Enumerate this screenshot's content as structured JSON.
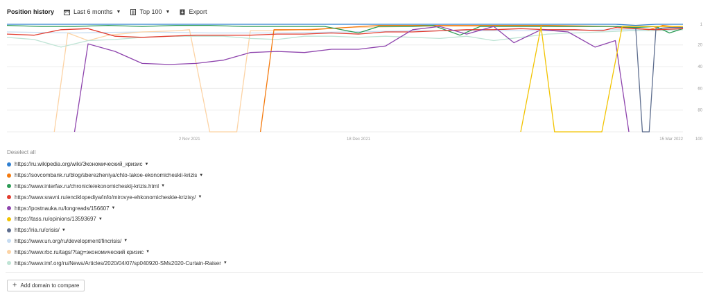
{
  "toolbar": {
    "title": "Position history",
    "period": "Last 6 months",
    "top": "Top 100",
    "export": "Export"
  },
  "deselect_all": "Deselect all",
  "add_domain": "Add domain to compare",
  "legend": [
    {
      "url": "https://ru.wikipedia.org/wiki/Экономический_кризис",
      "color": "#2f7fd1"
    },
    {
      "url": "https://sovcombank.ru/blog/sberezheniya/chto-takoe-ekonomicheskii-krizis",
      "color": "#f47a0e"
    },
    {
      "url": "https://www.interfax.ru/chronicle/ekonomicheskij-krizis.html",
      "color": "#2c9b55"
    },
    {
      "url": "https://www.sravni.ru/enciklopediya/info/mirovye-ehkonomicheskie-krizisy/",
      "color": "#e23b2e"
    },
    {
      "url": "https://postnauka.ru/longreads/156607",
      "color": "#8e44ad"
    },
    {
      "url": "https://tass.ru/opinions/13593697",
      "color": "#f2c300"
    },
    {
      "url": "https://ria.ru/crisis/",
      "color": "#5d6d8e"
    },
    {
      "url": "https://www.un.org/ru/development/fincrisis/",
      "color": "#c6dcf2"
    },
    {
      "url": "https://www.rbc.ru/tags/?tag=экономический кризис",
      "color": "#fcd3a5"
    },
    {
      "url": "https://www.imf.org/ru/News/Articles/2020/04/07/sp040920-SMs2020-Curtain-Raiser",
      "color": "#bfe4d5"
    }
  ],
  "chart_data": {
    "type": "line",
    "ylim": [
      1,
      100
    ],
    "y_ticks": [
      1,
      20,
      40,
      60,
      80,
      100
    ],
    "x_ticks": [
      {
        "label": "2 Nov 2021",
        "pos": 0.27
      },
      {
        "label": "18 Dec 2021",
        "pos": 0.52
      },
      {
        "label": "15 Mar 2022",
        "pos": 1.0
      }
    ],
    "series": [
      {
        "name": "https://ru.wikipedia.org/wiki/Экономический_кризис",
        "color": "#2f7fd1",
        "values": [
          [
            0,
            1
          ],
          [
            0.25,
            1
          ],
          [
            0.5,
            1
          ],
          [
            0.75,
            1
          ],
          [
            0.9,
            1
          ],
          [
            0.93,
            2
          ],
          [
            0.96,
            1
          ],
          [
            1,
            1
          ]
        ]
      },
      {
        "name": "https://sovcombank.ru/blog/sberezheniya/chto-takoe-ekonomicheskii-krizis",
        "color": "#f47a0e",
        "values": [
          [
            0.375,
            100
          ],
          [
            0.395,
            6
          ],
          [
            0.45,
            6
          ],
          [
            0.55,
            2
          ],
          [
            0.6,
            2
          ],
          [
            0.7,
            2
          ],
          [
            0.8,
            2
          ],
          [
            0.9,
            3
          ],
          [
            0.95,
            6
          ],
          [
            0.97,
            2
          ],
          [
            1,
            4
          ]
        ]
      },
      {
        "name": "https://www.interfax.ru/chronicle/ekonomicheskij-krizis.html",
        "color": "#2c9b55",
        "values": [
          [
            0,
            2
          ],
          [
            0.05,
            3
          ],
          [
            0.1,
            3
          ],
          [
            0.15,
            2
          ],
          [
            0.2,
            3
          ],
          [
            0.25,
            2
          ],
          [
            0.3,
            2
          ],
          [
            0.35,
            3
          ],
          [
            0.4,
            3
          ],
          [
            0.45,
            3
          ],
          [
            0.47,
            3
          ],
          [
            0.52,
            9
          ],
          [
            0.55,
            3
          ],
          [
            0.6,
            3
          ],
          [
            0.63,
            2
          ],
          [
            0.67,
            11
          ],
          [
            0.7,
            3
          ],
          [
            0.75,
            3
          ],
          [
            0.8,
            3
          ],
          [
            0.85,
            3
          ],
          [
            0.9,
            3
          ],
          [
            0.93,
            4
          ],
          [
            0.96,
            3
          ],
          [
            0.98,
            9
          ],
          [
            1,
            5
          ]
        ]
      },
      {
        "name": "https://www.sravni.ru/enciklopediya/info/mirovye-ehkonomicheskie-krizisy/",
        "color": "#e23b2e",
        "values": [
          [
            0,
            10
          ],
          [
            0.04,
            11
          ],
          [
            0.08,
            6
          ],
          [
            0.12,
            5
          ],
          [
            0.16,
            12
          ],
          [
            0.2,
            13
          ],
          [
            0.24,
            12
          ],
          [
            0.28,
            11
          ],
          [
            0.32,
            11
          ],
          [
            0.36,
            11
          ],
          [
            0.4,
            10
          ],
          [
            0.44,
            10
          ],
          [
            0.48,
            9
          ],
          [
            0.52,
            10
          ],
          [
            0.56,
            8
          ],
          [
            0.6,
            8
          ],
          [
            0.64,
            7
          ],
          [
            0.68,
            6
          ],
          [
            0.72,
            6
          ],
          [
            0.76,
            5
          ],
          [
            0.8,
            6
          ],
          [
            0.84,
            6
          ],
          [
            0.88,
            7
          ],
          [
            0.9,
            4
          ],
          [
            0.93,
            5
          ],
          [
            0.96,
            6
          ],
          [
            1,
            5
          ]
        ]
      },
      {
        "name": "https://postnauka.ru/longreads/156607",
        "color": "#8e44ad",
        "values": [
          [
            0.1,
            100
          ],
          [
            0.12,
            19
          ],
          [
            0.16,
            26
          ],
          [
            0.2,
            37
          ],
          [
            0.24,
            38
          ],
          [
            0.28,
            37
          ],
          [
            0.32,
            34
          ],
          [
            0.36,
            27
          ],
          [
            0.4,
            26
          ],
          [
            0.44,
            27
          ],
          [
            0.48,
            24
          ],
          [
            0.52,
            24
          ],
          [
            0.56,
            21
          ],
          [
            0.6,
            6
          ],
          [
            0.64,
            3
          ],
          [
            0.68,
            10
          ],
          [
            0.72,
            3
          ],
          [
            0.75,
            18
          ],
          [
            0.79,
            6
          ],
          [
            0.83,
            8
          ],
          [
            0.87,
            22
          ],
          [
            0.9,
            16
          ],
          [
            0.92,
            100
          ]
        ]
      },
      {
        "name": "https://tass.ru/opinions/13593697",
        "color": "#f2c300",
        "values": [
          [
            0.76,
            100
          ],
          [
            0.79,
            3
          ],
          [
            0.81,
            100
          ],
          [
            0.88,
            100
          ],
          [
            0.91,
            3
          ],
          [
            0.93,
            3
          ],
          [
            0.96,
            3
          ],
          [
            1,
            3
          ]
        ]
      },
      {
        "name": "https://ria.ru/crisis/",
        "color": "#5d6d8e",
        "values": [
          [
            0.93,
            4
          ],
          [
            0.94,
            100
          ],
          [
            0.95,
            100
          ],
          [
            0.96,
            5
          ],
          [
            0.98,
            4
          ],
          [
            1,
            4
          ]
        ]
      },
      {
        "name": "https://www.un.org/ru/development/fincrisis/",
        "color": "#c6dcf2",
        "values": [
          [
            0,
            8
          ],
          [
            0.1,
            9
          ],
          [
            0.2,
            8
          ],
          [
            0.3,
            9
          ],
          [
            0.4,
            9
          ],
          [
            0.5,
            8
          ],
          [
            0.6,
            7
          ],
          [
            0.7,
            7
          ],
          [
            0.8,
            7
          ],
          [
            0.9,
            6
          ],
          [
            1,
            6
          ]
        ]
      },
      {
        "name": "https://www.rbc.ru/tags/?tag=экономический кризис",
        "color": "#fcd3a5",
        "values": [
          [
            0.07,
            100
          ],
          [
            0.09,
            9
          ],
          [
            0.12,
            16
          ],
          [
            0.15,
            11
          ],
          [
            0.2,
            8
          ],
          [
            0.25,
            7
          ],
          [
            0.27,
            6
          ],
          [
            0.3,
            100
          ],
          [
            0.34,
            100
          ],
          [
            0.36,
            7
          ],
          [
            0.4,
            7
          ],
          [
            0.5,
            4
          ],
          [
            0.6,
            3
          ],
          [
            0.7,
            3
          ],
          [
            0.8,
            3
          ],
          [
            0.9,
            3
          ],
          [
            1,
            3
          ]
        ]
      },
      {
        "name": "https://www.imf.org/ru/News/Articles/2020/04/07/sp040920-SMs2020-Curtain-Raiser",
        "color": "#bfe4d5",
        "values": [
          [
            0,
            13
          ],
          [
            0.04,
            15
          ],
          [
            0.08,
            22
          ],
          [
            0.12,
            16
          ],
          [
            0.16,
            15
          ],
          [
            0.2,
            13
          ],
          [
            0.24,
            12
          ],
          [
            0.28,
            12
          ],
          [
            0.32,
            12
          ],
          [
            0.36,
            14
          ],
          [
            0.4,
            15
          ],
          [
            0.44,
            12
          ],
          [
            0.48,
            12
          ],
          [
            0.52,
            13
          ],
          [
            0.56,
            12
          ],
          [
            0.6,
            13
          ],
          [
            0.64,
            14
          ],
          [
            0.68,
            12
          ],
          [
            0.72,
            16
          ],
          [
            0.76,
            13
          ],
          [
            0.8,
            10
          ],
          [
            0.84,
            9
          ],
          [
            0.88,
            8
          ],
          [
            0.92,
            7
          ],
          [
            0.96,
            7
          ],
          [
            1,
            6
          ]
        ]
      }
    ]
  }
}
